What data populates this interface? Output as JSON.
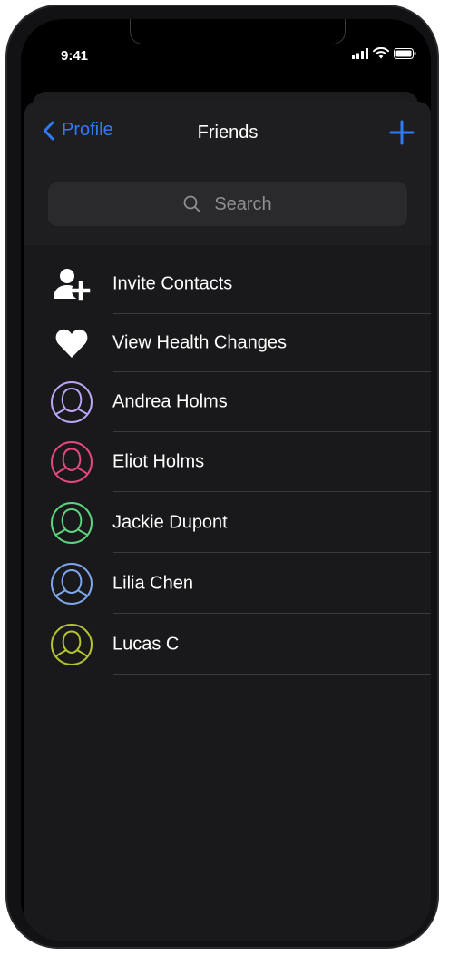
{
  "status_bar": {
    "time": "9:41"
  },
  "nav": {
    "back_label": "Profile",
    "title": "Friends",
    "add_icon": "plus-icon"
  },
  "search": {
    "placeholder": "Search"
  },
  "actions": [
    {
      "label": "Invite Contacts",
      "icon": "add-user-icon"
    },
    {
      "label": "View Health Changes",
      "icon": "heart-icon"
    }
  ],
  "friends": [
    {
      "name": "Andrea Holms",
      "color": "#b9a6f5"
    },
    {
      "name": "Eliot Holms",
      "color": "#e5487f"
    },
    {
      "name": "Jackie Dupont",
      "color": "#5fd47f"
    },
    {
      "name": "Lilia Chen",
      "color": "#7ea6ec"
    },
    {
      "name": "Lucas C",
      "color": "#b4c42e"
    }
  ],
  "colors": {
    "accent": "#2f7bf6",
    "background": "#19181a",
    "text": "#ffffff"
  }
}
